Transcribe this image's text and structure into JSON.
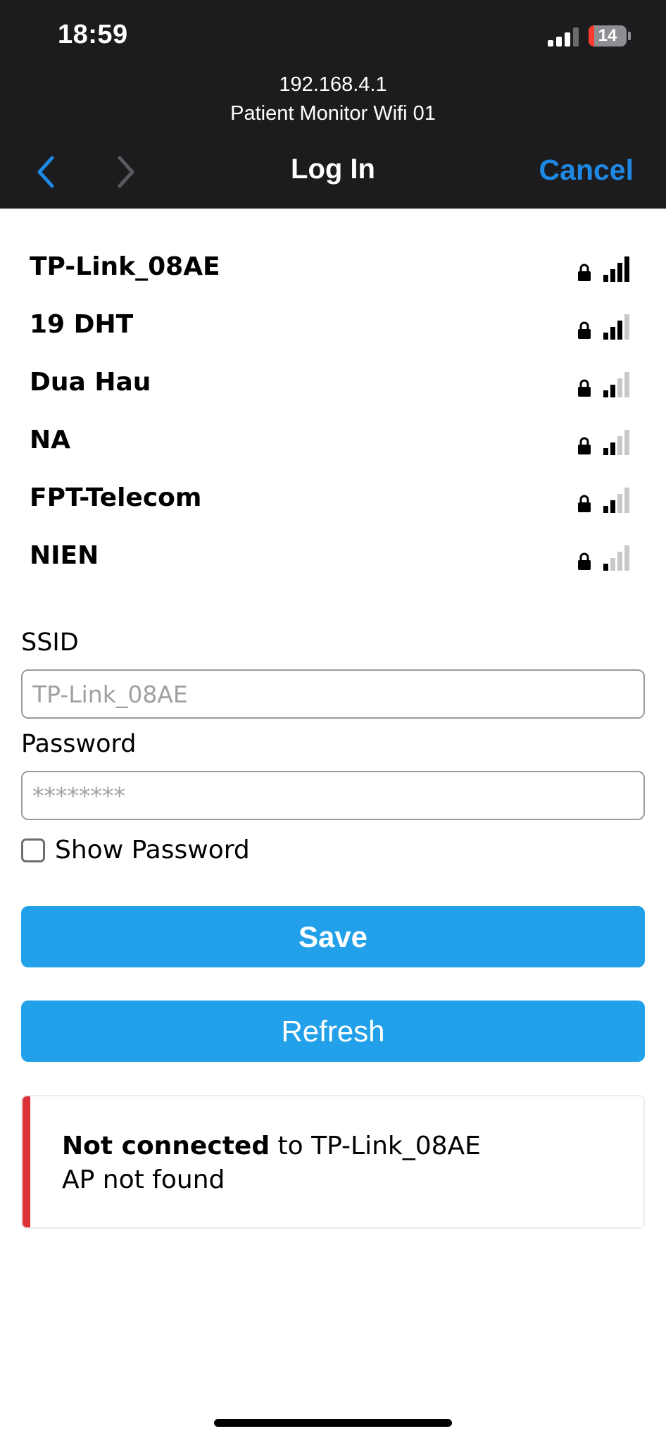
{
  "status_bar": {
    "time": "18:59",
    "battery_level": "14",
    "battery_fraction": 0.14,
    "signal_bars": 3
  },
  "browser": {
    "host": "192.168.4.1",
    "page_title": "Patient Monitor Wifi 01",
    "nav_title": "Log In",
    "cancel_label": "Cancel"
  },
  "networks": [
    {
      "name": "TP-Link_08AE",
      "signal": 4
    },
    {
      "name": "19 DHT",
      "signal": 3
    },
    {
      "name": "Dua Hau",
      "signal": 2
    },
    {
      "name": "NA",
      "signal": 2
    },
    {
      "name": "FPT-Telecom",
      "signal": 2
    },
    {
      "name": "NIEN",
      "signal": 1
    }
  ],
  "form": {
    "ssid_label": "SSID",
    "ssid_placeholder": "TP-Link_08AE",
    "ssid_value": "",
    "password_label": "Password",
    "password_placeholder": "********",
    "password_value": "",
    "show_password_label": "Show Password",
    "show_password_checked": false,
    "save_label": "Save",
    "refresh_label": "Refresh"
  },
  "status": {
    "state_bold": "Not connected",
    "state_rest": " to TP-Link_08AE",
    "detail": "AP not found"
  },
  "colors": {
    "accent": "#22a1ea",
    "error": "#dc3136",
    "nav_link": "#1e88e5",
    "topbar": "#1c1c1e"
  },
  "icons": {
    "lock": "lock-icon",
    "signal": "wifi-signal-icon",
    "back": "chevron-left-icon",
    "forward": "chevron-right-icon"
  }
}
